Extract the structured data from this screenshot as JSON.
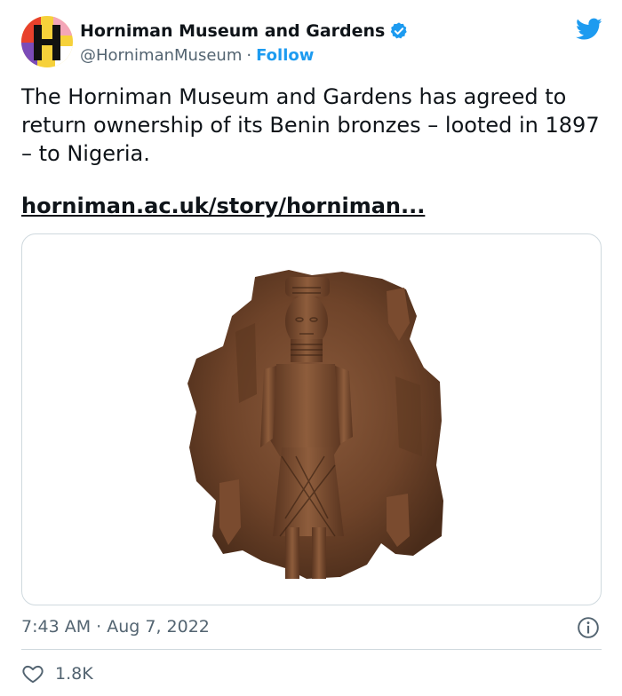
{
  "author": {
    "display_name": "Horniman Museum and Gardens",
    "handle": "@HornimanMuseum",
    "separator": "·",
    "follow_label": "Follow",
    "verified_icon": "verified-badge-icon",
    "avatar_letter": "H"
  },
  "tweet": {
    "text": "The Horniman Museum and Gardens has agreed to return ownership of its Benin bronzes – looted in 1897 – to Nigeria.",
    "link_text": "horniman.ac.uk/story/horniman..."
  },
  "meta": {
    "timestamp": "7:43 AM · Aug 7, 2022",
    "like_count": "1.8K"
  },
  "icons": {
    "brand": "twitter-bird-icon",
    "info": "info-icon",
    "like": "heart-icon"
  },
  "colors": {
    "accent": "#1d9bf0",
    "text": "#0f1419",
    "secondary": "#536471",
    "border": "#cfd9de"
  }
}
